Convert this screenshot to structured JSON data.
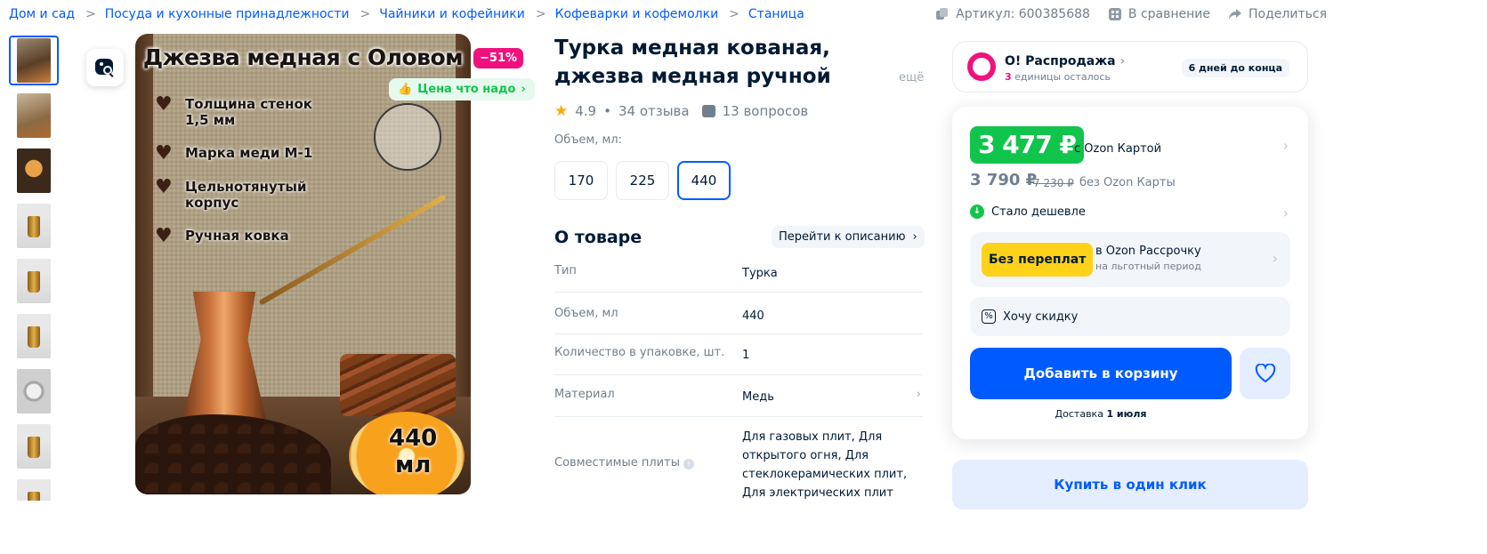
{
  "breadcrumbs": [
    "Дом и сад",
    "Посуда и кухонные принадлежности",
    "Чайники и кофейники",
    "Кофеварки и кофемолки",
    "Станица"
  ],
  "meta": {
    "article": "Артикул: 600385688",
    "compare": "В сравнение",
    "share": "Поделиться"
  },
  "gallery": {
    "image_title": "Джезва медная с Оловом",
    "features": [
      "Толщина стенок\n 1,5 мм",
      "Марка меди М-1",
      "Цельнотянутый\n корпус",
      "Ручная ковка"
    ],
    "volume_label": "440\nмл",
    "discount_badge": "−51%",
    "price_badge": "Цена что надо",
    "thumb_icons": [
      "photo-thumb",
      "photo-thumb",
      "photo-thumb",
      "photo-thumb",
      "photo-thumb",
      "photo-thumb",
      "photo-thumb",
      "photo-thumb",
      "photo-thumb"
    ]
  },
  "product": {
    "title": "Турка медная кованая, джезва медная ручной работы, медная",
    "more": "ещё",
    "rating": "4.9",
    "reviews": "34 отзыва",
    "questions": "13 вопросов",
    "volume_caption": "Объем, мл:",
    "volumes": [
      "170",
      "225",
      "440"
    ],
    "selected_volume": "440"
  },
  "about": {
    "heading": "О товаре",
    "goto": "Перейти к описанию",
    "specs": [
      {
        "k": "Тип",
        "v": "Турка"
      },
      {
        "k": "Объем, мл",
        "v": "440"
      },
      {
        "k": "Количество в упаковке, шт.",
        "v": "1"
      },
      {
        "k": "Материал",
        "v": "Медь"
      },
      {
        "k": "Совместимые плиты",
        "v": "Для газовых плит, Для открытого огня, Для стеклокерамических плит, Для электрических плит"
      }
    ]
  },
  "sale": {
    "title": "О! Распродажа",
    "left_count": "3",
    "left_text": " единицы осталось",
    "days": "6 дней до конца"
  },
  "price": {
    "with_card": "3 477 ₽",
    "with_card_caption": "с Ozon Картой",
    "without_card": "3 790 ₽",
    "crossed": "7 230 ₽",
    "without_card_caption": "без Ozon Карты",
    "cheaper": "Стало дешевле",
    "installment_badge": "Без переплат",
    "installment_title": "в Ozon Рассрочку",
    "installment_sub": "на льготный период",
    "want_discount": "Хочу скидку",
    "add_to_cart": "Добавить в корзину",
    "delivery_prefix": "Доставка ",
    "delivery_date": "1 июля",
    "buy_one_click": "Купить в один клик"
  },
  "colors": {
    "accent": "#005bff",
    "green": "#10c44c",
    "pink": "#f1117e",
    "yellow": "#ffd21a"
  }
}
